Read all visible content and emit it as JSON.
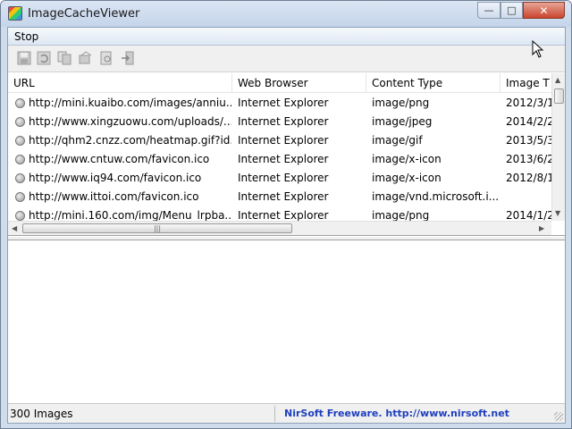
{
  "window": {
    "title": "ImageCacheViewer",
    "controls": {
      "minimize": "—",
      "maximize": "□",
      "close": "✕"
    }
  },
  "menu": {
    "items": [
      "Stop"
    ]
  },
  "toolbar": {
    "icons": [
      "save-icon",
      "refresh-icon",
      "copy-icon",
      "html-report-icon",
      "properties-icon",
      "exit-icon"
    ]
  },
  "table": {
    "columns": [
      "URL",
      "Web Browser",
      "Content Type",
      "Image T"
    ],
    "rows": [
      {
        "url": "http://mini.kuaibo.com/images/anniu...",
        "browser": "Internet Explorer",
        "type": "image/png",
        "time": "2012/3/1"
      },
      {
        "url": "http://www.xingzuowu.com/uploads/...",
        "browser": "Internet Explorer",
        "type": "image/jpeg",
        "time": "2014/2/2"
      },
      {
        "url": "http://qhm2.cnzz.com/heatmap.gif?id...",
        "browser": "Internet Explorer",
        "type": "image/gif",
        "time": "2013/5/3"
      },
      {
        "url": "http://www.cntuw.com/favicon.ico",
        "browser": "Internet Explorer",
        "type": "image/x-icon",
        "time": "2013/6/2"
      },
      {
        "url": "http://www.iq94.com/favicon.ico",
        "browser": "Internet Explorer",
        "type": "image/x-icon",
        "time": "2012/8/1"
      },
      {
        "url": "http://www.ittoi.com/favicon.ico",
        "browser": "Internet Explorer",
        "type": "image/vnd.microsoft.i...",
        "time": ""
      },
      {
        "url": "http://mini.160.com/img/Menu_lrpba...",
        "browser": "Internet Explorer",
        "type": "image/png",
        "time": "2014/1/2"
      }
    ]
  },
  "status": {
    "count": "300 Images",
    "credit": "NirSoft Freeware.  http://www.nirsoft.net"
  }
}
